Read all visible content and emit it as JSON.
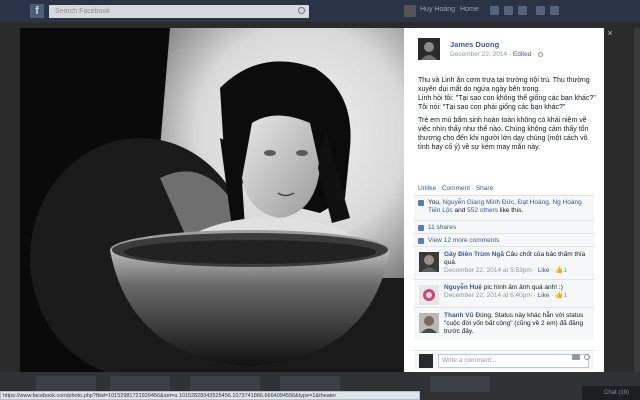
{
  "topbar": {
    "search_placeholder": "Search Facebook",
    "user_name": "Huy Hoàng",
    "home_label": "Home"
  },
  "post": {
    "author": "James Duong",
    "date": "December 22, 2014",
    "edited_label": "Edited",
    "caption": [
      "Thu và Linh ăn cơm trưa tại trường nội trú. Thu thường xuyên dụi mắt do ngứa ngày bên trong.",
      "Linh hỏi tôi: \"Tại sao con không thể giống các bạn khác?\" Tôi nói: \"Tại sao con phải giống các bạn khác?\"",
      "Trẻ em mù bẩm sinh hoàn toàn không có khái niệm về việc nhìn thấy như thế nào. Chúng không cảm thấy tổn thương cho đến khi người lớn dạy chúng (một cách vô tình hay cố ý) về sự kém may mắn này."
    ],
    "actions": {
      "unlike": "Unlike",
      "comment": "Comment",
      "share": "Share"
    }
  },
  "ufi": {
    "likes_prefix": "You, ",
    "likes_names": "Nguyễn Giang Minh Đức, Đạt Hoàng, Ng Hoàng Tiến Lộc",
    "likes_and": " and ",
    "likes_others": "552 others",
    "likes_suffix": " like this.",
    "shares": "11 shares",
    "view_more": "View 12 more comments"
  },
  "comments": [
    {
      "name": "Gây Điên Trùm Ngã",
      "text": " Câu chốt của bác thấm thía quá.",
      "date": "December 22, 2014 at 5:53pm",
      "like": "Like",
      "count": "1"
    },
    {
      "name": "Nguyễn Huệ",
      "text": " pic hình ảm ảnh quá anh! :)",
      "date": "December 22, 2014 at 6:40pm",
      "like": "Like",
      "count": "1"
    },
    {
      "name": "Thanh Vũ",
      "text": " Đúng. Status này khác hẳn với status \"cuộc đời vốn bất công\" (cũng về 2 em) đã đăng trước đây.",
      "date": "",
      "like": "",
      "count": ""
    }
  ],
  "write_comment_placeholder": "Write a comment...",
  "statusbar_url": "https://www.facebook.com/photo.php?fbid=10152981721929456&set=a.10152828343525456.1073741866.6664094556&type=1&theater",
  "chat_label": "Chat (19)"
}
